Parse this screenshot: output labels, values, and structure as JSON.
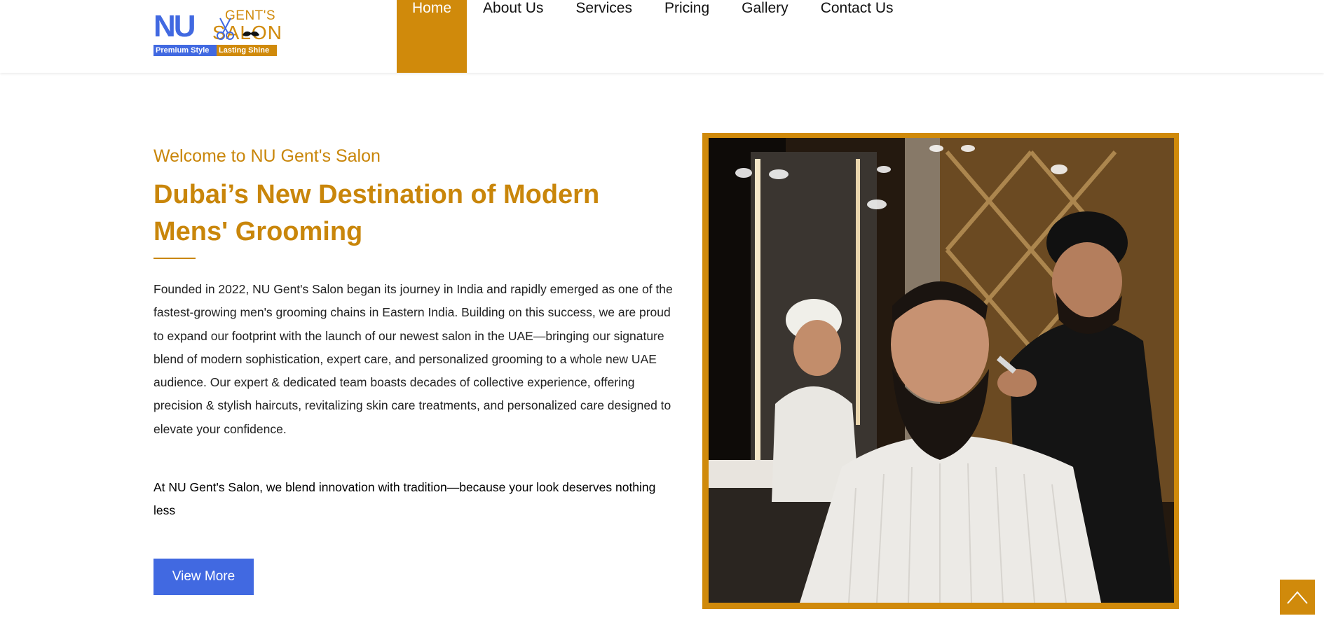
{
  "logo": {
    "nu": "NU",
    "gents": "GENT'S",
    "salon": "SALON",
    "tagline_left": "Premium Style",
    "tagline_right": "Lasting Shine"
  },
  "nav": {
    "items": [
      {
        "label": "Home",
        "active": true
      },
      {
        "label": "About Us",
        "active": false
      },
      {
        "label": "Services",
        "active": false
      },
      {
        "label": "Pricing",
        "active": false
      },
      {
        "label": "Gallery",
        "active": false
      },
      {
        "label": "Contact Us",
        "active": false
      }
    ]
  },
  "hero": {
    "welcome": "Welcome to NU Gent's Salon",
    "headline": "Dubai’s New Destination of Modern Mens' Grooming",
    "description": "Founded in 2022, NU Gent's Salon began its journey in India and rapidly emerged as one of the fastest-growing men's grooming chains in Eastern India. Building on this success, we are proud to expand our footprint with the launch of our newest salon in the UAE—bringing our signature blend of modern sophistication, expert care, and personalized grooming to a whole new UAE audience. Our expert & dedicated team boasts decades of collective experience, offering precision & stylish haircuts, revitalizing skin care treatments, and personalized care designed to elevate your confidence.",
    "tagline": "At NU Gent's Salon, we blend innovation with tradition—because your look deserves nothing less",
    "button_label": "View More"
  },
  "colors": {
    "gold": "#d08a0b",
    "blue": "#4169e1",
    "text": "#222222"
  },
  "icons": {
    "logo_scissors": "scissors-icon",
    "logo_mustache": "mustache-icon",
    "scroll_top": "chevron-up-icon"
  }
}
